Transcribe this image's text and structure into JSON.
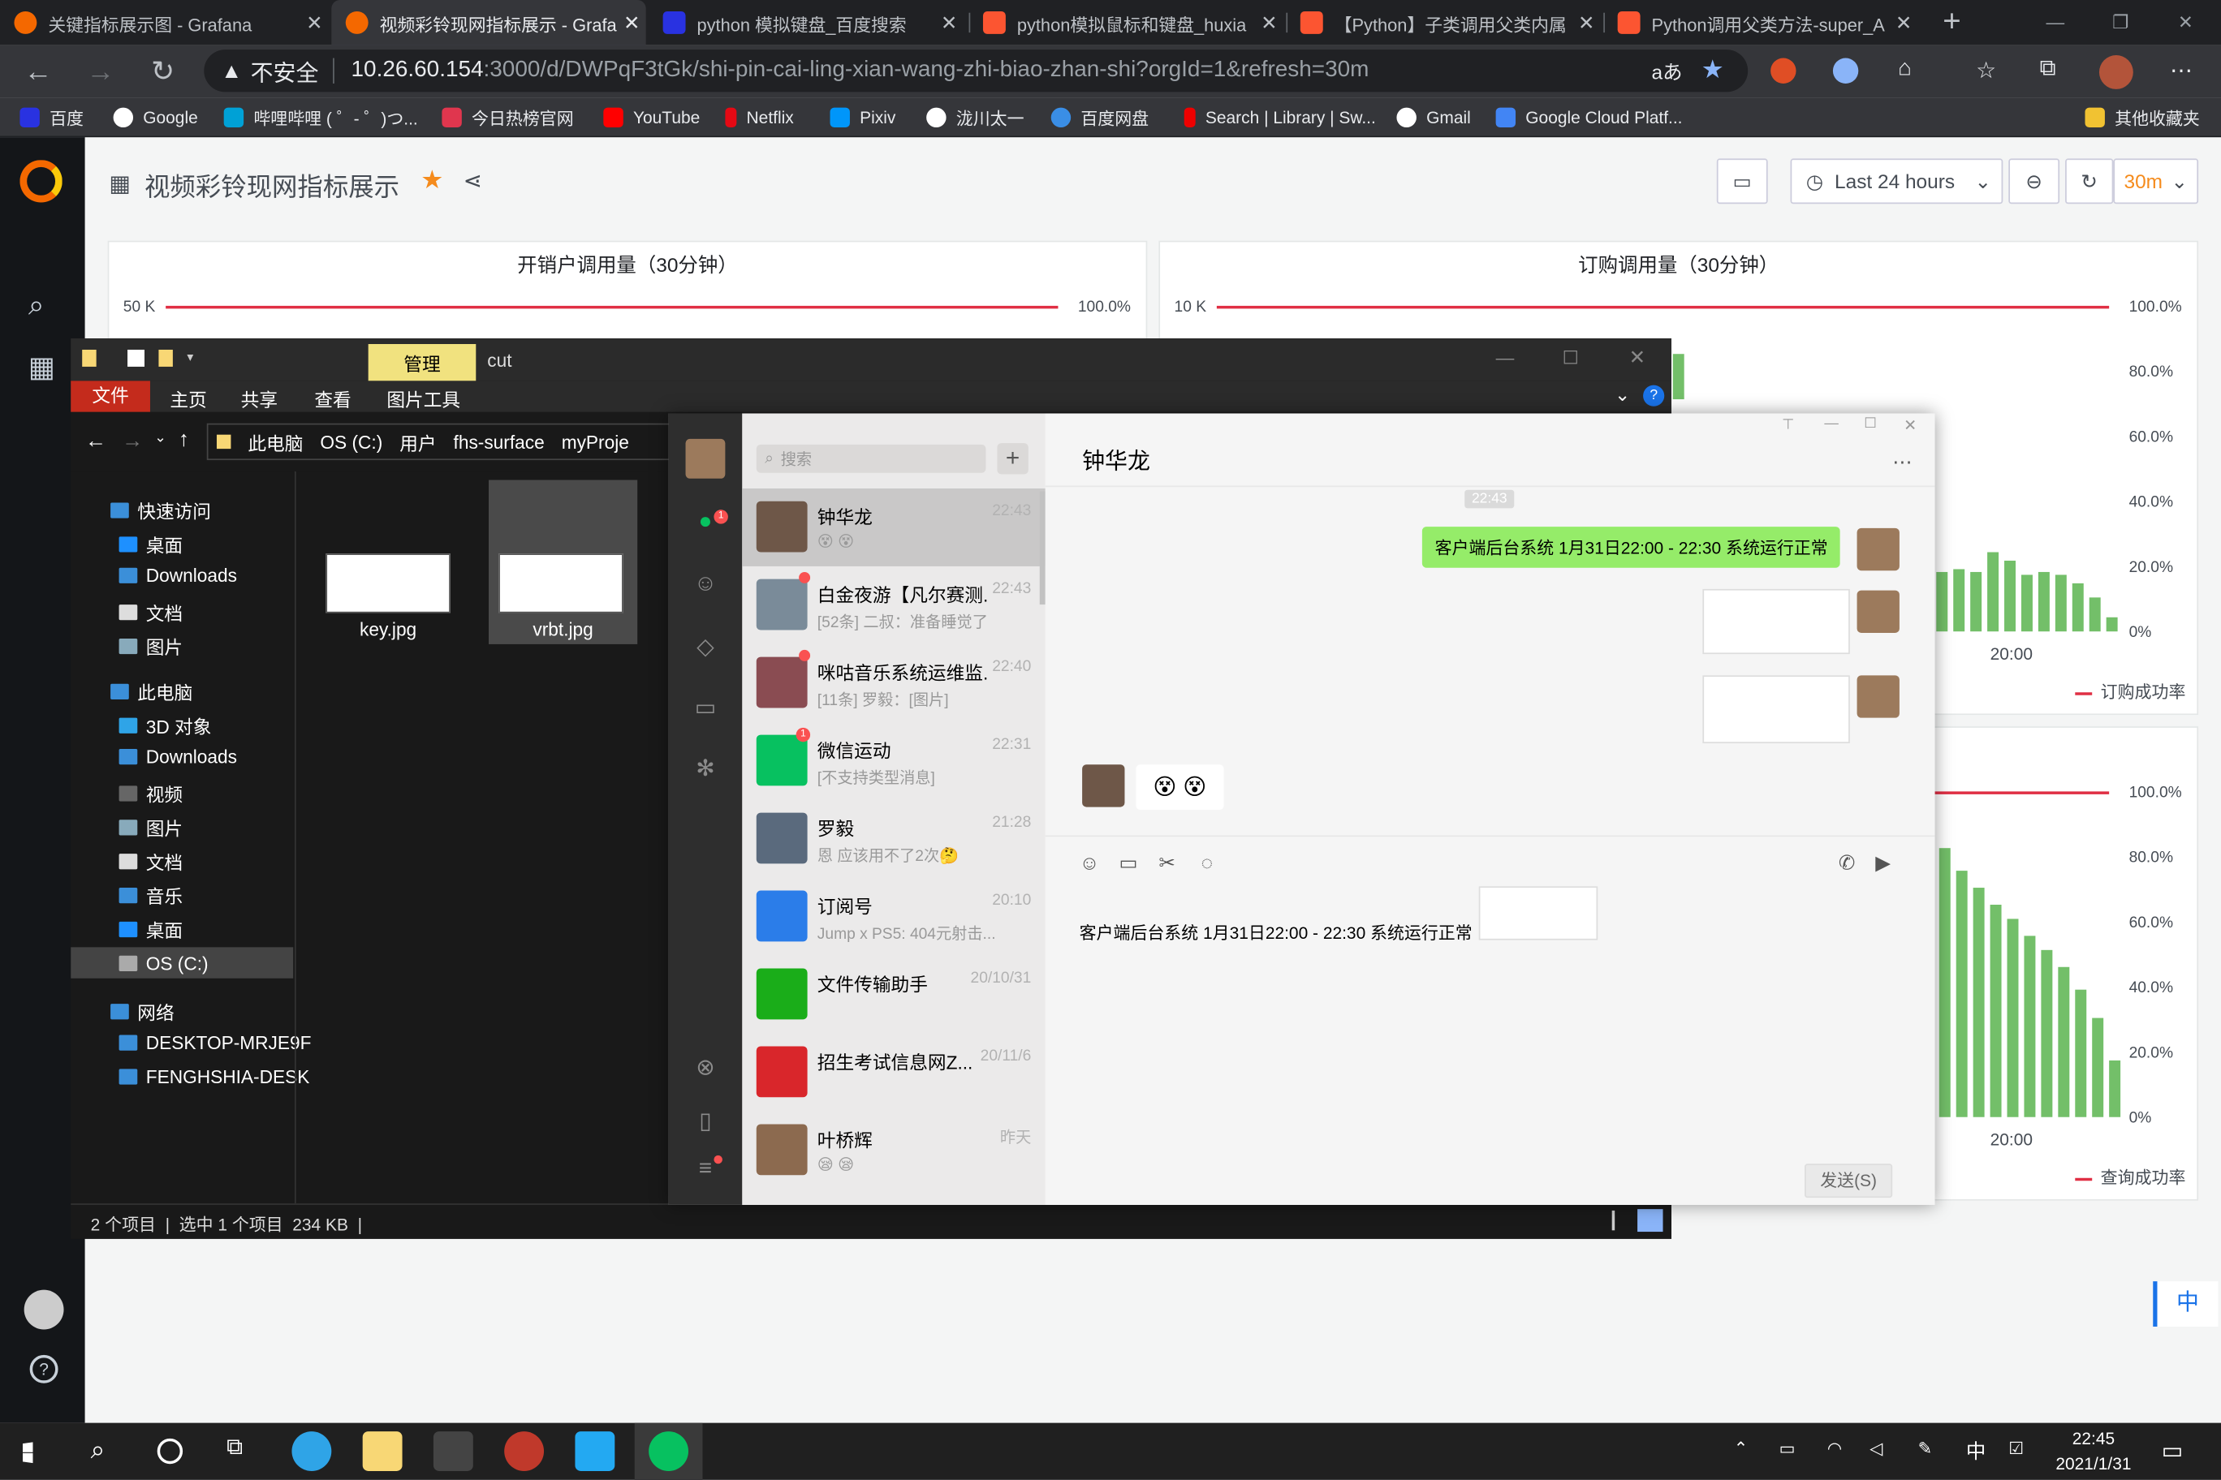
{
  "browser": {
    "tabs": [
      {
        "title": "关键指标展示图 - Grafana",
        "color": "#f46800"
      },
      {
        "title": "视频彩铃现网指标展示 - Grafa",
        "color": "#f46800"
      },
      {
        "title": "python 模拟键盘_百度搜索",
        "color": "#2932e1"
      },
      {
        "title": "python模拟鼠标和键盘_huxia",
        "color": "#fc5531"
      },
      {
        "title": "【Python】子类调用父类内属",
        "color": "#fc5531"
      },
      {
        "title": "Python调用父类方法-super_A",
        "color": "#fc5531"
      }
    ],
    "insecure_label": "不安全",
    "url_host": "10.26.60.154",
    "url_rest": ":3000/d/DWPqF3tGk/shi-pin-cai-ling-xian-wang-zhi-biao-zhan-shi?orgId=1&refresh=30m",
    "bookmarks": [
      "百度",
      "Google",
      "哔哩哔哩 ( ゜- ゜)つ...",
      "今日热榜官网",
      "YouTube",
      "Netflix",
      "Pixiv",
      "泷川太一",
      "百度网盘",
      "Search | Library | Sw...",
      "Gmail",
      "Google Cloud Platf..."
    ],
    "other_bookmarks": "其他收藏夹"
  },
  "grafana": {
    "dashboard_title": "视频彩铃现网指标展示",
    "time_range": "Last 24 hours",
    "refresh": "30m",
    "panels": [
      {
        "title": "开销户调用量（30分钟）",
        "left_top": "50 K",
        "right_top": "100.0%"
      },
      {
        "title": "订购调用量（30分钟）",
        "left_top": "10 K",
        "right_axis": [
          "100.0%",
          "80.0%",
          "60.0%",
          "40.0%",
          "20.0%",
          "0%"
        ],
        "x_tick": "20:00",
        "legend": "订购成功率"
      },
      {
        "right_axis": [
          "100.0%",
          "80.0%",
          "60.0%",
          "40.0%",
          "20.0%",
          "0%"
        ],
        "x_tick": "20:00",
        "legend": "查询成功率"
      }
    ],
    "ime": "中"
  },
  "explorer": {
    "tab_manage": "管理",
    "title": "cut",
    "ribbon": [
      "文件",
      "主页",
      "共享",
      "查看",
      "图片工具"
    ],
    "path": [
      "此电脑",
      "OS (C:)",
      "用户",
      "fhs-surface",
      "myProje"
    ],
    "tree": [
      "快速访问",
      "桌面",
      "Downloads",
      "文档",
      "图片",
      "此电脑",
      "3D 对象",
      "Downloads",
      "视频",
      "图片",
      "文档",
      "音乐",
      "桌面",
      "OS (C:)",
      "网络",
      "DESKTOP-MRJE9F",
      "FENGHSHIA-DESK"
    ],
    "files": [
      "key.jpg",
      "vrbt.jpg"
    ],
    "status": "2 个项目  |  选中 1 个项目  234 KB  |"
  },
  "wechat": {
    "search_placeholder": "搜索",
    "chats": [
      {
        "name": "钟华龙",
        "msg": "😵 😵",
        "time": "22:43"
      },
      {
        "name": "白金夜游【凡尔赛测...",
        "msg": "[52条] 二叔：准备睡觉了",
        "time": "22:43"
      },
      {
        "name": "咪咕音乐系统运维监...",
        "msg": "[11条] 罗毅：[图片]",
        "time": "22:40"
      },
      {
        "name": "微信运动",
        "msg": "[不支持类型消息]",
        "time": "22:31"
      },
      {
        "name": "罗毅",
        "msg": "恩 应该用不了2次🤔",
        "time": "21:28"
      },
      {
        "name": "订阅号",
        "msg": "Jump x PS5: 404元射击...",
        "time": "20:10"
      },
      {
        "name": "文件传输助手",
        "msg": "",
        "time": "20/10/31"
      },
      {
        "name": "招生考试信息网Z...",
        "msg": "",
        "time": "20/11/6"
      },
      {
        "name": "叶桥辉",
        "msg": "😪 😪",
        "time": "昨天"
      }
    ],
    "chat_title": "钟华龙",
    "time_stamp": "22:43",
    "sent_text": "客户端后台系统 1月31日22:00 - 22:30 系统运行正常",
    "received": "😵 😵",
    "draft_text": "客户端后台系统 1月31日22:00 - 22:30 系统运行正常",
    "send_label": "发送(S)"
  },
  "taskbar": {
    "time": "22:45",
    "date": "2021/1/31",
    "ime": "中"
  }
}
